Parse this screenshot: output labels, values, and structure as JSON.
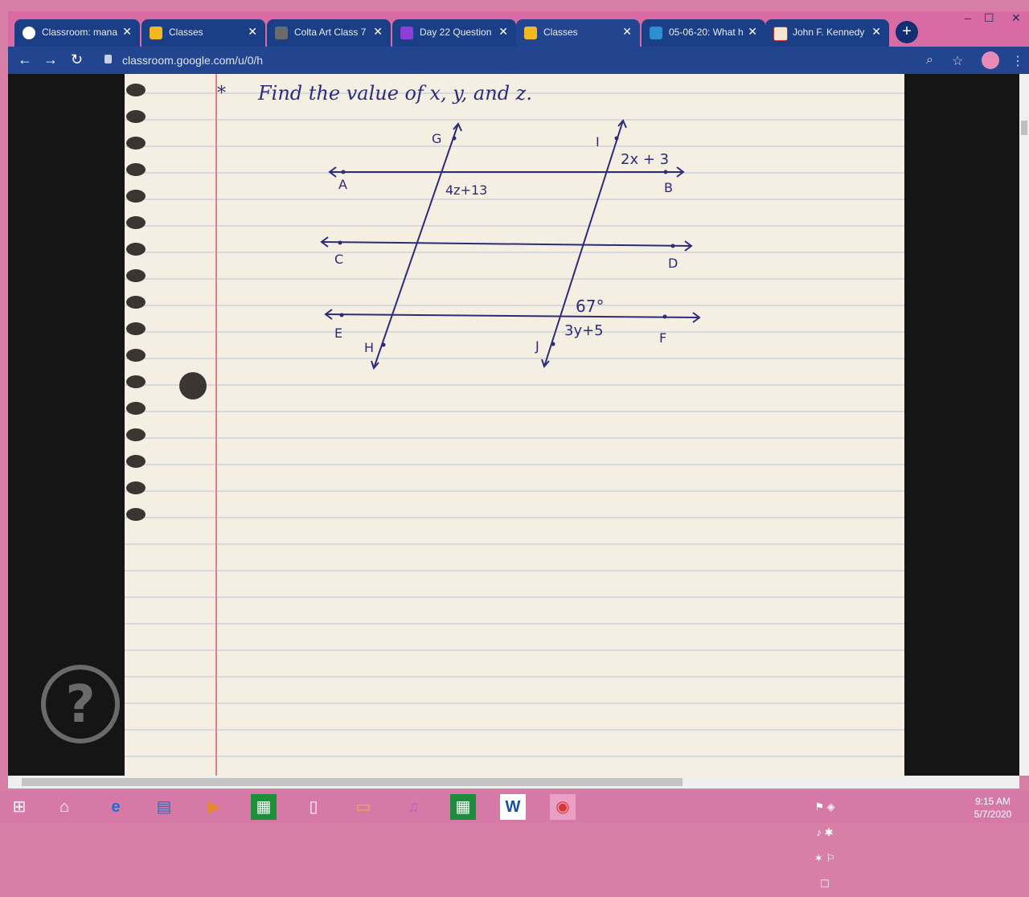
{
  "browser": {
    "tabs": [
      {
        "title": "Classroom: mana",
        "icon": "google-icon"
      },
      {
        "title": "Classes",
        "icon": "classroom-icon"
      },
      {
        "title": "Colta Art Class 7",
        "icon": "classroom-icon"
      },
      {
        "title": "Day 22 Question",
        "icon": "classroom-icon"
      },
      {
        "title": "Classes",
        "icon": "classroom-icon"
      },
      {
        "title": "05-06-20: What h",
        "icon": "classroom-icon"
      },
      {
        "title": "John F. Kennedy",
        "icon": "jfk-icon"
      }
    ],
    "url": "classroom.google.com/u/0/h"
  },
  "worksheet": {
    "bullet": "*",
    "instruction": "Find the value of x, y, and z.",
    "points": {
      "A": "A",
      "B": "B",
      "C": "C",
      "D": "D",
      "E": "E",
      "F": "F",
      "G": "G",
      "H": "H",
      "I": "I",
      "J": "J"
    },
    "labels": {
      "top_right": "2x + 3",
      "top_left": "4z+13",
      "bottom_right_angle": "67°",
      "bottom_right_expr": "3y+5"
    }
  },
  "help": {
    "symbol": "?"
  },
  "taskbar": {
    "time": "9:15 AM",
    "date": "5/7/2020"
  },
  "colors": {
    "chrome": "#1b356f",
    "tab_strip": "#d86aa4",
    "ink": "#2c2c7a",
    "paper": "#f4efe2",
    "margin": "#e57d88"
  }
}
